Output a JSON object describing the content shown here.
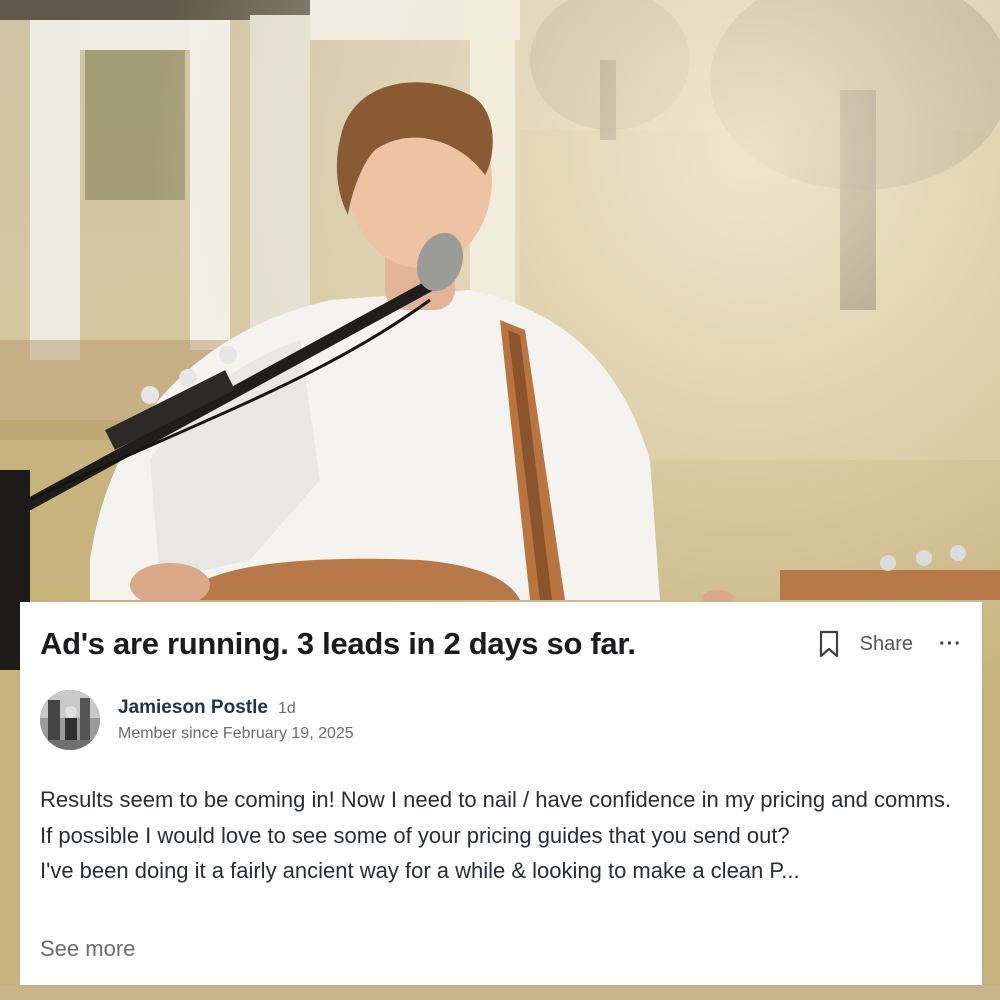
{
  "post": {
    "title": "Ad's are running. 3 leads in 2 days so far.",
    "share_label": "Share",
    "more_label": "···",
    "author": {
      "name": "Jamieson Postle",
      "time": "1d",
      "member_since": "Member since February 19, 2025"
    },
    "body": [
      "Results seem to be coming in! Now I need to nail / have confidence in my pricing and comms. If possible I would love to see some of your pricing guides that you send out?",
      "I've been doing it a fairly ancient way for a while & looking to make a clean P..."
    ],
    "see_more_label": "See more"
  },
  "icons": {
    "bookmark": "bookmark-icon",
    "more": "more-options-icon"
  },
  "colors": {
    "card_background": "#ffffff",
    "title": "#1c1c1e",
    "muted": "#6b6b70"
  }
}
